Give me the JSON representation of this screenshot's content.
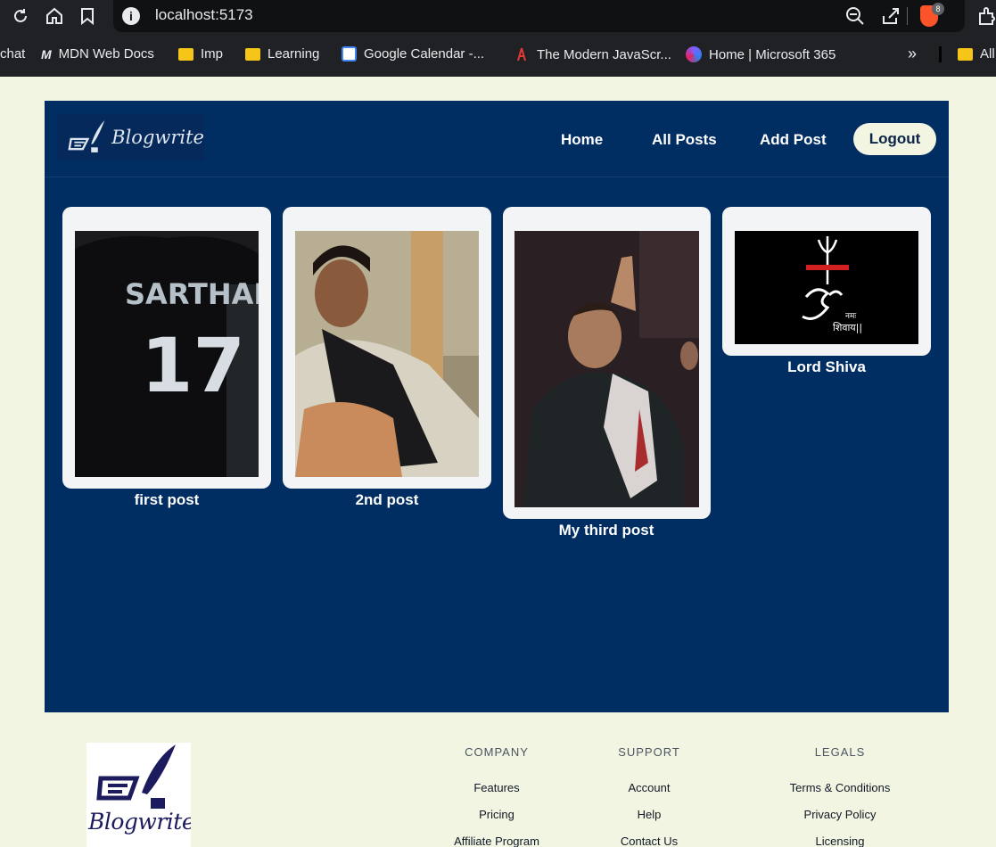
{
  "browser": {
    "url": "localhost:5173",
    "ext_badge": "8",
    "bookmarks": [
      "chat",
      "MDN Web Docs",
      "Imp",
      "Learning",
      "Google Calendar -...",
      "The Modern JavaScr...",
      "Home | Microsoft 365",
      "All"
    ],
    "more": "»"
  },
  "header": {
    "logo_text": "Blogwrite",
    "nav": [
      "Home",
      "All Posts",
      "Add Post"
    ],
    "logout_label": "Logout"
  },
  "posts": [
    {
      "title": "first post",
      "image": "jersey-photo"
    },
    {
      "title": "2nd post",
      "image": "person-photo"
    },
    {
      "title": "My third post",
      "image": "footballer-photo"
    },
    {
      "title": "Lord Shiva",
      "image": "om-trishul-image"
    }
  ],
  "post_image_text": {
    "jersey_name": "SARTHAK",
    "jersey_number": "17",
    "om_caption_1": "नमः",
    "om_caption_2": "शिवाय||"
  },
  "footer": {
    "logo_text": "Blogwrite",
    "columns": [
      {
        "heading": "COMPANY",
        "links": [
          "Features",
          "Pricing",
          "Affiliate Program"
        ]
      },
      {
        "heading": "SUPPORT",
        "links": [
          "Account",
          "Help",
          "Contact Us"
        ]
      },
      {
        "heading": "LEGALS",
        "links": [
          "Terms & Conditions",
          "Privacy Policy",
          "Licensing"
        ]
      }
    ]
  },
  "colors": {
    "page_bg": "#f1f5e1",
    "app_bg": "#002d62",
    "card_bg": "#f3f4f6",
    "logout_bg": "#f1f5e1"
  }
}
